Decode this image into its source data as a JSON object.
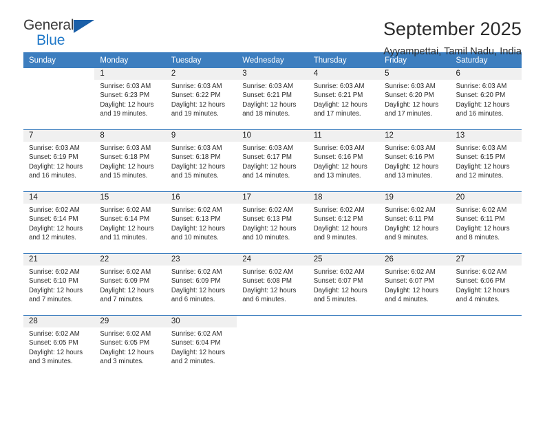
{
  "brand": {
    "name_part1": "General",
    "name_part2": "Blue",
    "triangle_color": "#1a5fa8",
    "blue_color": "#1f78c8"
  },
  "header": {
    "title": "September 2025",
    "subtitle": "Ayyampettai, Tamil Nadu, India"
  },
  "theme": {
    "header_blue": "#3d7ebf",
    "day_band_gray": "#f0f0f0",
    "text_color": "#2b2b2b"
  },
  "weekdays": [
    "Sunday",
    "Monday",
    "Tuesday",
    "Wednesday",
    "Thursday",
    "Friday",
    "Saturday"
  ],
  "weeks": [
    [
      {
        "day": "",
        "sunrise": "",
        "sunset": "",
        "daylight1": "",
        "daylight2": ""
      },
      {
        "day": "1",
        "sunrise": "Sunrise: 6:03 AM",
        "sunset": "Sunset: 6:23 PM",
        "daylight1": "Daylight: 12 hours",
        "daylight2": "and 19 minutes."
      },
      {
        "day": "2",
        "sunrise": "Sunrise: 6:03 AM",
        "sunset": "Sunset: 6:22 PM",
        "daylight1": "Daylight: 12 hours",
        "daylight2": "and 19 minutes."
      },
      {
        "day": "3",
        "sunrise": "Sunrise: 6:03 AM",
        "sunset": "Sunset: 6:21 PM",
        "daylight1": "Daylight: 12 hours",
        "daylight2": "and 18 minutes."
      },
      {
        "day": "4",
        "sunrise": "Sunrise: 6:03 AM",
        "sunset": "Sunset: 6:21 PM",
        "daylight1": "Daylight: 12 hours",
        "daylight2": "and 17 minutes."
      },
      {
        "day": "5",
        "sunrise": "Sunrise: 6:03 AM",
        "sunset": "Sunset: 6:20 PM",
        "daylight1": "Daylight: 12 hours",
        "daylight2": "and 17 minutes."
      },
      {
        "day": "6",
        "sunrise": "Sunrise: 6:03 AM",
        "sunset": "Sunset: 6:20 PM",
        "daylight1": "Daylight: 12 hours",
        "daylight2": "and 16 minutes."
      }
    ],
    [
      {
        "day": "7",
        "sunrise": "Sunrise: 6:03 AM",
        "sunset": "Sunset: 6:19 PM",
        "daylight1": "Daylight: 12 hours",
        "daylight2": "and 16 minutes."
      },
      {
        "day": "8",
        "sunrise": "Sunrise: 6:03 AM",
        "sunset": "Sunset: 6:18 PM",
        "daylight1": "Daylight: 12 hours",
        "daylight2": "and 15 minutes."
      },
      {
        "day": "9",
        "sunrise": "Sunrise: 6:03 AM",
        "sunset": "Sunset: 6:18 PM",
        "daylight1": "Daylight: 12 hours",
        "daylight2": "and 15 minutes."
      },
      {
        "day": "10",
        "sunrise": "Sunrise: 6:03 AM",
        "sunset": "Sunset: 6:17 PM",
        "daylight1": "Daylight: 12 hours",
        "daylight2": "and 14 minutes."
      },
      {
        "day": "11",
        "sunrise": "Sunrise: 6:03 AM",
        "sunset": "Sunset: 6:16 PM",
        "daylight1": "Daylight: 12 hours",
        "daylight2": "and 13 minutes."
      },
      {
        "day": "12",
        "sunrise": "Sunrise: 6:03 AM",
        "sunset": "Sunset: 6:16 PM",
        "daylight1": "Daylight: 12 hours",
        "daylight2": "and 13 minutes."
      },
      {
        "day": "13",
        "sunrise": "Sunrise: 6:03 AM",
        "sunset": "Sunset: 6:15 PM",
        "daylight1": "Daylight: 12 hours",
        "daylight2": "and 12 minutes."
      }
    ],
    [
      {
        "day": "14",
        "sunrise": "Sunrise: 6:02 AM",
        "sunset": "Sunset: 6:14 PM",
        "daylight1": "Daylight: 12 hours",
        "daylight2": "and 12 minutes."
      },
      {
        "day": "15",
        "sunrise": "Sunrise: 6:02 AM",
        "sunset": "Sunset: 6:14 PM",
        "daylight1": "Daylight: 12 hours",
        "daylight2": "and 11 minutes."
      },
      {
        "day": "16",
        "sunrise": "Sunrise: 6:02 AM",
        "sunset": "Sunset: 6:13 PM",
        "daylight1": "Daylight: 12 hours",
        "daylight2": "and 10 minutes."
      },
      {
        "day": "17",
        "sunrise": "Sunrise: 6:02 AM",
        "sunset": "Sunset: 6:13 PM",
        "daylight1": "Daylight: 12 hours",
        "daylight2": "and 10 minutes."
      },
      {
        "day": "18",
        "sunrise": "Sunrise: 6:02 AM",
        "sunset": "Sunset: 6:12 PM",
        "daylight1": "Daylight: 12 hours",
        "daylight2": "and 9 minutes."
      },
      {
        "day": "19",
        "sunrise": "Sunrise: 6:02 AM",
        "sunset": "Sunset: 6:11 PM",
        "daylight1": "Daylight: 12 hours",
        "daylight2": "and 9 minutes."
      },
      {
        "day": "20",
        "sunrise": "Sunrise: 6:02 AM",
        "sunset": "Sunset: 6:11 PM",
        "daylight1": "Daylight: 12 hours",
        "daylight2": "and 8 minutes."
      }
    ],
    [
      {
        "day": "21",
        "sunrise": "Sunrise: 6:02 AM",
        "sunset": "Sunset: 6:10 PM",
        "daylight1": "Daylight: 12 hours",
        "daylight2": "and 7 minutes."
      },
      {
        "day": "22",
        "sunrise": "Sunrise: 6:02 AM",
        "sunset": "Sunset: 6:09 PM",
        "daylight1": "Daylight: 12 hours",
        "daylight2": "and 7 minutes."
      },
      {
        "day": "23",
        "sunrise": "Sunrise: 6:02 AM",
        "sunset": "Sunset: 6:09 PM",
        "daylight1": "Daylight: 12 hours",
        "daylight2": "and 6 minutes."
      },
      {
        "day": "24",
        "sunrise": "Sunrise: 6:02 AM",
        "sunset": "Sunset: 6:08 PM",
        "daylight1": "Daylight: 12 hours",
        "daylight2": "and 6 minutes."
      },
      {
        "day": "25",
        "sunrise": "Sunrise: 6:02 AM",
        "sunset": "Sunset: 6:07 PM",
        "daylight1": "Daylight: 12 hours",
        "daylight2": "and 5 minutes."
      },
      {
        "day": "26",
        "sunrise": "Sunrise: 6:02 AM",
        "sunset": "Sunset: 6:07 PM",
        "daylight1": "Daylight: 12 hours",
        "daylight2": "and 4 minutes."
      },
      {
        "day": "27",
        "sunrise": "Sunrise: 6:02 AM",
        "sunset": "Sunset: 6:06 PM",
        "daylight1": "Daylight: 12 hours",
        "daylight2": "and 4 minutes."
      }
    ],
    [
      {
        "day": "28",
        "sunrise": "Sunrise: 6:02 AM",
        "sunset": "Sunset: 6:05 PM",
        "daylight1": "Daylight: 12 hours",
        "daylight2": "and 3 minutes."
      },
      {
        "day": "29",
        "sunrise": "Sunrise: 6:02 AM",
        "sunset": "Sunset: 6:05 PM",
        "daylight1": "Daylight: 12 hours",
        "daylight2": "and 3 minutes."
      },
      {
        "day": "30",
        "sunrise": "Sunrise: 6:02 AM",
        "sunset": "Sunset: 6:04 PM",
        "daylight1": "Daylight: 12 hours",
        "daylight2": "and 2 minutes."
      },
      {
        "day": "",
        "sunrise": "",
        "sunset": "",
        "daylight1": "",
        "daylight2": ""
      },
      {
        "day": "",
        "sunrise": "",
        "sunset": "",
        "daylight1": "",
        "daylight2": ""
      },
      {
        "day": "",
        "sunrise": "",
        "sunset": "",
        "daylight1": "",
        "daylight2": ""
      },
      {
        "day": "",
        "sunrise": "",
        "sunset": "",
        "daylight1": "",
        "daylight2": ""
      }
    ]
  ]
}
